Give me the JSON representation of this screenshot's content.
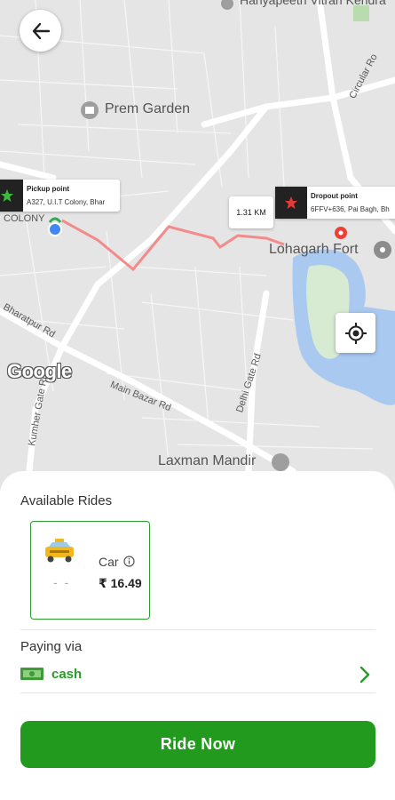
{
  "map": {
    "places": {
      "top_partial": "Hanyapeeth Vitran Kendra",
      "prem_garden": "Prem Garden",
      "lohagarh_fort": "Lohagarh Fort",
      "laxman_mandir": "Laxman Mandir",
      "colony": "COLONY"
    },
    "roads": {
      "circular": "Circular Ro",
      "bharatpur": "Bharatpur Rd",
      "main_bazar": "Main Bazar Rd",
      "delhi_gate": "Delhi Gate Rd",
      "kumher_gate": "Kumher Gate Rd"
    },
    "pickup": {
      "title": "Pickup point",
      "address": "A327, U.I.T Colony, Bhar"
    },
    "dropoff": {
      "title": "Dropout point",
      "address": "6FFV+636, Pai Bagh, Bh"
    },
    "distance": "1.31 KM",
    "attribution": "Google",
    "colors": {
      "route": "#f28b8b",
      "water": "#a9c9f0",
      "park": "#b8dcae"
    }
  },
  "sheet": {
    "available_title": "Available Rides",
    "ride": {
      "name": "Car",
      "dash": "- -",
      "price": "₹ 16.49"
    },
    "paying_title": "Paying via",
    "payment_method": "cash",
    "cta": "Ride Now"
  },
  "colors": {
    "accent": "#219a1e",
    "border": "#2f9a2f"
  }
}
